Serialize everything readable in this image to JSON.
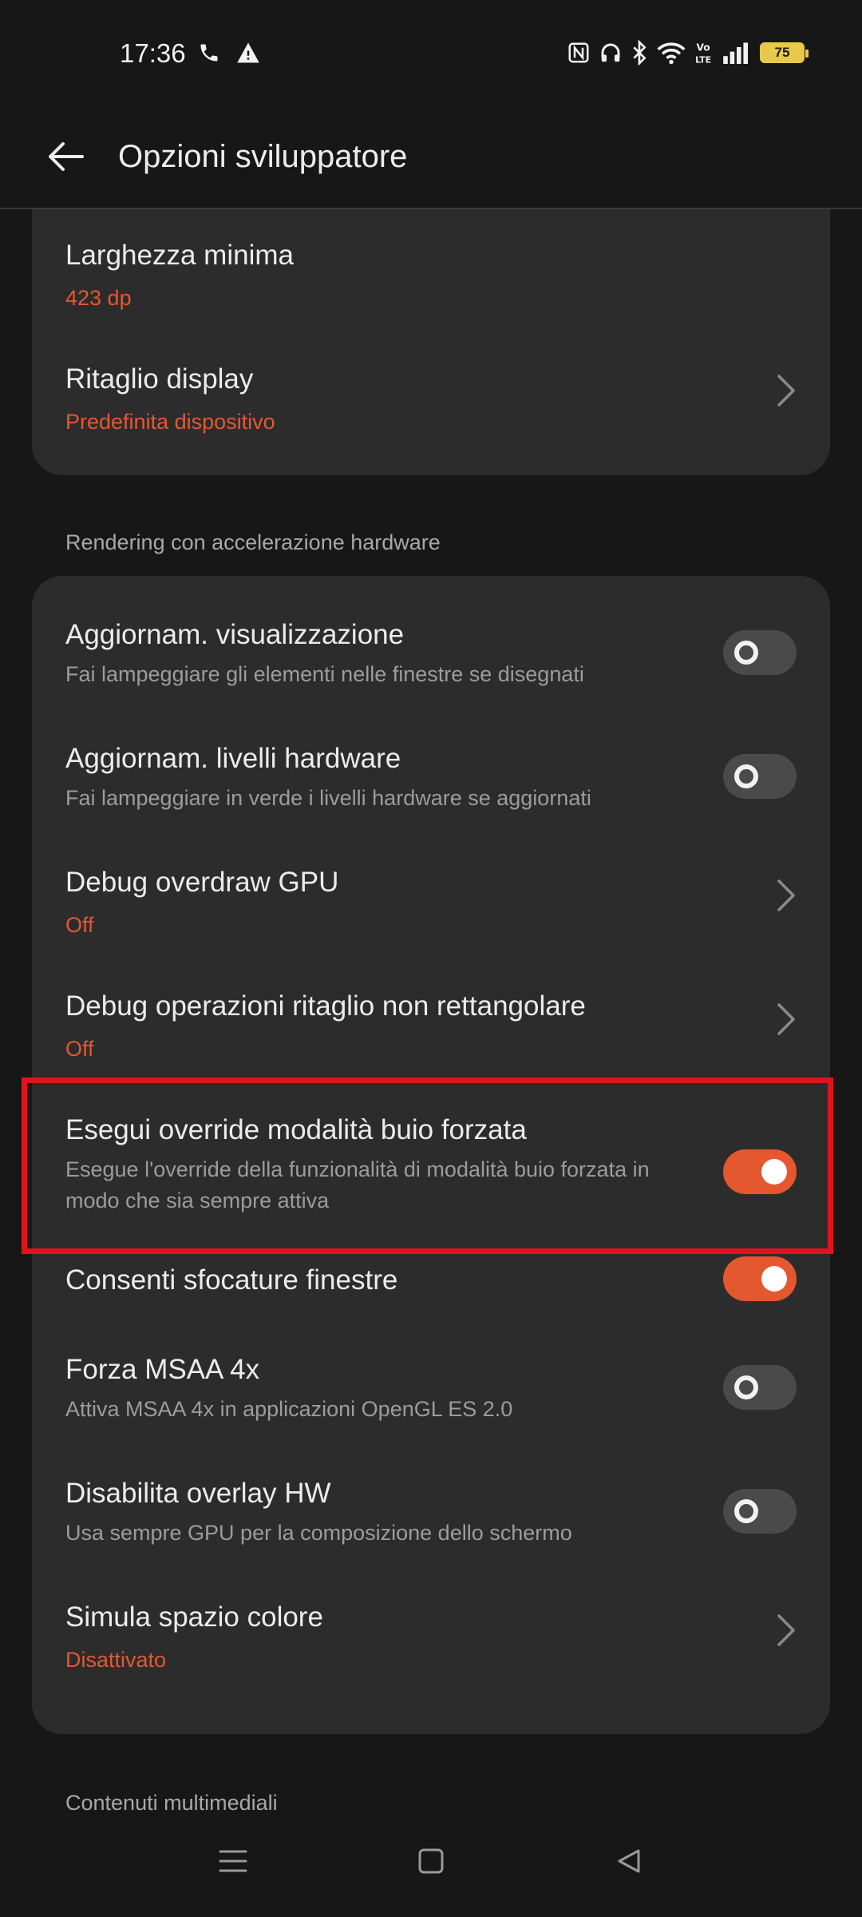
{
  "status_bar": {
    "time": "17:36",
    "battery_level": "75",
    "icons_left": [
      "phone-icon",
      "warning-icon"
    ],
    "icons_right": [
      "nfc-icon",
      "headphones-icon",
      "bluetooth-icon",
      "wifi-icon",
      "volte-icon",
      "signal-icon",
      "battery-icon"
    ]
  },
  "app_bar": {
    "title": "Opzioni sviluppatore"
  },
  "card1": {
    "items": [
      {
        "title": "Larghezza minima",
        "value": "423 dp"
      },
      {
        "title": "Ritaglio display",
        "value": "Predefinita dispositivo"
      }
    ]
  },
  "section_hw": {
    "header": "Rendering con accelerazione hardware",
    "items": [
      {
        "title": "Aggiornam. visualizzazione",
        "subtitle": "Fai lampeggiare gli elementi nelle finestre se disegnati",
        "toggle": false
      },
      {
        "title": "Aggiornam. livelli hardware",
        "subtitle": "Fai lampeggiare in verde i livelli hardware se aggiornati",
        "toggle": false
      },
      {
        "title": "Debug overdraw GPU",
        "value": "Off"
      },
      {
        "title": "Debug operazioni ritaglio non rettangolare",
        "value": "Off"
      },
      {
        "title": "Esegui override modalità buio forzata",
        "subtitle": "Esegue l'override della funzionalità di modalità buio forzata in modo che sia sempre attiva",
        "toggle": true
      },
      {
        "title": "Consenti sfocature finestre",
        "toggle": true
      },
      {
        "title": "Forza MSAA 4x",
        "subtitle": "Attiva MSAA 4x in applicazioni OpenGL ES 2.0",
        "toggle": false
      },
      {
        "title": "Disabilita overlay HW",
        "subtitle": "Usa sempre GPU per la composizione dello schermo",
        "toggle": false
      },
      {
        "title": "Simula spazio colore",
        "value": "Disattivato"
      }
    ]
  },
  "section_media": {
    "header": "Contenuti multimediali"
  },
  "colors": {
    "accent": "#e5572f",
    "highlight": "#e0141a",
    "card_bg": "#2c2c2c",
    "page_bg": "#171717"
  }
}
